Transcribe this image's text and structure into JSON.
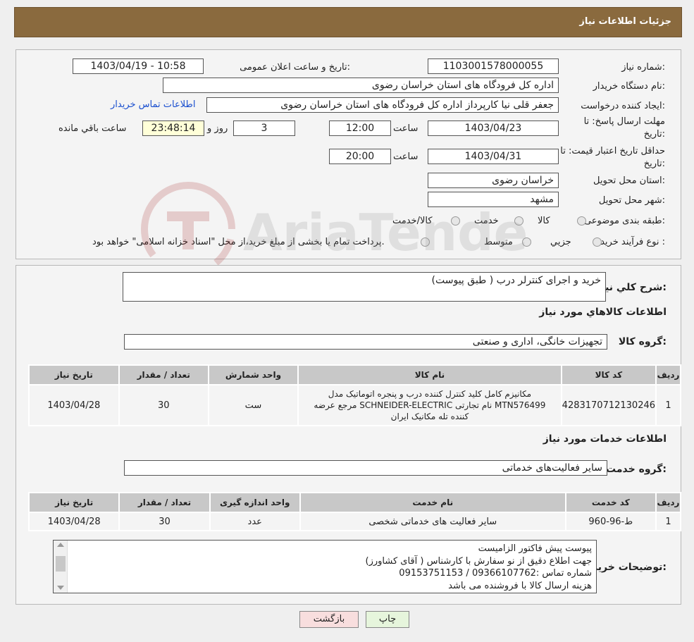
{
  "header": {
    "title": "جزئیات اطلاعات نیاز"
  },
  "info": {
    "need_number_label": "شماره نیاز:",
    "need_number": "1103001578000055",
    "announce_label": "تاریخ و ساعت اعلان عمومی:",
    "announce_value": "1403/04/19 - 10:58",
    "buyer_org_label": "نام دستگاه خریدار:",
    "buyer_org": "اداره کل فرودگاه های استان خراسان رضوی",
    "requester_label": "ایجاد کننده درخواست:",
    "requester": "جعفر قلی نیا کارپرداز اداره کل فرودگاه های استان خراسان رضوی",
    "contact_link": "اطلاعات تماس خریدار",
    "deadline_label_1": "مهلت ارسال پاسخ: تا",
    "deadline_label_2": "تاریخ:",
    "deadline_date": "1403/04/23",
    "time_label": "ساعت",
    "deadline_time": "12:00",
    "days_value": "3",
    "days_label": "روز و",
    "remaining_time": "23:48:14",
    "remaining_label": "ساعت باقي مانده",
    "validity_label_1": "حداقل تاریخ اعتبار قیمت: تا",
    "validity_label_2": "تاریخ:",
    "validity_date": "1403/04/31",
    "validity_time": "20:00",
    "province_label": "استان محل تحویل:",
    "province": "خراسان رضوی",
    "city_label": "شهر محل تحویل:",
    "city": "مشهد",
    "category_label": "طبقه بندی موضوعی:",
    "category_options": [
      "کالا",
      "خدمت",
      "کالا/خدمت"
    ],
    "process_label": "نوع فرآیند خرید :",
    "process_options": [
      "جزیي",
      "متوسط"
    ],
    "process_note": "پرداخت تمام یا بخشی از مبلغ خرید،از محل \"اسناد خزانه اسلامی\" خواهد بود."
  },
  "description": {
    "label": "شرح کلي نياز:",
    "value": "خرید و اجرای کنترلر درب ( طبق پیوست)"
  },
  "goods": {
    "section_title": "اطلاعات کالاهاي مورد نياز",
    "group_label": "گروه کالا:",
    "group_value": "تجهیزات خانگی، اداری و صنعتی",
    "columns": [
      "رديف",
      "کد کالا",
      "نام کالا",
      "واحد شمارش",
      "تعداد / مقدار",
      "تاریخ نیاز"
    ],
    "rows": [
      {
        "row": "1",
        "code": "4283170712130246",
        "name_line1": "مکانیزم کامل کلید کنترل کننده درب و پنجره اتوماتیک مدل",
        "name_line2": "MTN576499 نام تجارتی SCHNEIDER-ELECTRIC مرجع عرضه",
        "name_line3": "کننده تله مکانیک ایران",
        "unit": "ست",
        "qty": "30",
        "date": "1403/04/28"
      }
    ]
  },
  "services": {
    "section_title": "اطلاعات خدمات مورد نياز",
    "group_label": "گروه خدمت:",
    "group_value": "سایر فعالیت‌های خدماتی",
    "columns": [
      "رديف",
      "کد خدمت",
      "نام خدمت",
      "واحد اندازه گیری",
      "تعداد / مقدار",
      "تاریخ نیاز"
    ],
    "rows": [
      {
        "row": "1",
        "code": "ط-96-960",
        "name": "سایر فعالیت های خدماتی شخصی",
        "unit": "عدد",
        "qty": "30",
        "date": "1403/04/28"
      }
    ]
  },
  "notes": {
    "label": "توضيحات خريدار:",
    "line1": "پیوست پیش فاکتور الزامیست",
    "line2": "جهت اطلاع دقیق از نو سفارش با کارشناس   ( آقای کشاورز)",
    "line3": "شماره تماس :09366107762    /    09153751153",
    "line4": "هزینه ارسال کالا با فروشنده می باشد"
  },
  "buttons": {
    "print": "چاپ",
    "back": "بازگشت"
  },
  "watermark": {
    "text": "AriaTender.neT"
  },
  "colors": {
    "header_bg": "#8a6a3e",
    "link": "#1a4fcf",
    "print_btn": "#e6f5dc",
    "back_btn": "#f8dede"
  }
}
